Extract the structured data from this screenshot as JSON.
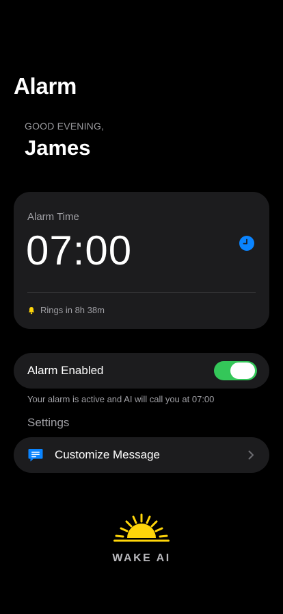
{
  "header": {
    "title": "Alarm",
    "greeting": "GOOD EVENING,",
    "user_name": "James"
  },
  "alarm_card": {
    "label": "Alarm Time",
    "time": "07:00",
    "icon": "clock-icon",
    "rings_icon": "bell-icon",
    "rings_text": "Rings in 8h 38m"
  },
  "alarm_toggle": {
    "label": "Alarm Enabled",
    "enabled": true,
    "status_text": "Your alarm is active and AI will call you at 07:00"
  },
  "settings": {
    "section_title": "Settings",
    "items": [
      {
        "label": "Customize Message",
        "icon": "message-icon"
      }
    ]
  },
  "brand": {
    "name": "WAKE AI",
    "logo_icon": "sun-icon"
  },
  "colors": {
    "background": "#000000",
    "card": "#1c1c1e",
    "accent_blue": "#0a84ff",
    "toggle_on": "#34c759",
    "bell": "#ffd60a",
    "sun": "#ffd60a",
    "secondary_text": "#a0a0a5"
  }
}
